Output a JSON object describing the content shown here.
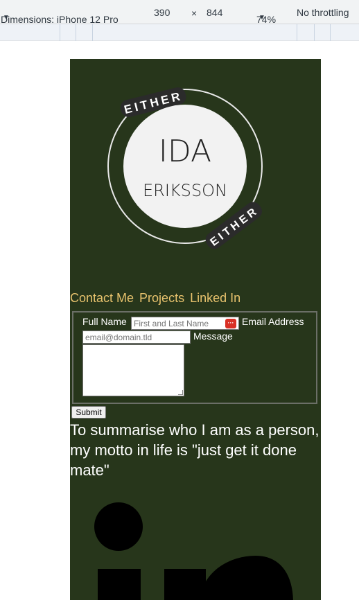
{
  "devtools": {
    "dimensions_label": "Dimensions: iPhone 12 Pro",
    "width": "390",
    "times": "×",
    "height": "844",
    "zoom": "74%",
    "throttling": "No throttling"
  },
  "logo": {
    "ring_top_text": "EITHER",
    "ring_bottom_text": "EITHER",
    "first_name": "IDA",
    "last_name": "ERIKSSON"
  },
  "nav": {
    "items": [
      "Contact Me",
      "Projects",
      "Linked In"
    ]
  },
  "form": {
    "full_name_label": "Full Name",
    "full_name_placeholder": "First and Last Name",
    "email_label": "Email Address",
    "email_placeholder": "email@domain.tld",
    "message_label": "Message",
    "submit_label": "Submit"
  },
  "motto": "To summarise who I am as a person, my motto in life is \"just get it done mate\"",
  "colors": {
    "background": "#27361b",
    "nav_link": "#e7c26d",
    "text": "#ffffff"
  }
}
